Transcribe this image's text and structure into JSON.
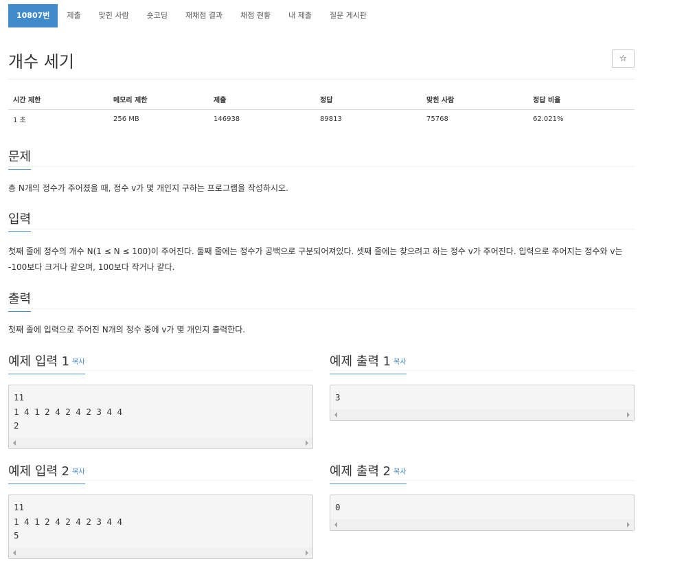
{
  "tabs": [
    {
      "label": "10807번",
      "active": true
    },
    {
      "label": "제출"
    },
    {
      "label": "맞힌 사람"
    },
    {
      "label": "숏코딩"
    },
    {
      "label": "재채점 결과"
    },
    {
      "label": "채점 현황"
    },
    {
      "label": "내 제출"
    },
    {
      "label": "질문 게시판"
    }
  ],
  "header": {
    "title": "개수 세기",
    "star_icon": "☆"
  },
  "stats": {
    "headers": [
      "시간 제한",
      "메모리 제한",
      "제출",
      "정답",
      "맞힌 사람",
      "정답 비율"
    ],
    "values": [
      "1 초",
      "256 MB",
      "146938",
      "89813",
      "75768",
      "62.021%"
    ]
  },
  "problem": {
    "title": "문제",
    "text": "총 N개의 정수가 주어졌을 때, 정수 v가 몇 개인지 구하는 프로그램을 작성하시오."
  },
  "input": {
    "title": "입력",
    "text": "첫째 줄에 정수의 개수 N(1 ≤ N ≤ 100)이 주어진다. 둘째 줄에는 정수가 공백으로 구분되어져있다. 셋째 줄에는 찾으려고 하는 정수 v가 주어진다. 입력으로 주어지는 정수와 v는 -100보다 크거나 같으며, 100보다 작거나 같다."
  },
  "output": {
    "title": "출력",
    "text": "첫째 줄에 입력으로 주어진 N개의 정수 중에 v가 몇 개인지 출력한다."
  },
  "samples": {
    "copy_label": "복사",
    "input1": {
      "title": "예제 입력 1",
      "content": "11\n1 4 1 2 4 2 4 2 3 4 4\n2"
    },
    "output1": {
      "title": "예제 출력 1",
      "content": "3"
    },
    "input2": {
      "title": "예제 입력 2",
      "content": "11\n1 4 1 2 4 2 4 2 3 4 4\n5"
    },
    "output2": {
      "title": "예제 출력 2",
      "content": "0"
    }
  },
  "colors": {
    "accent": "#428bca",
    "sample_bg": "#f5f5f5",
    "text": "#333333"
  }
}
